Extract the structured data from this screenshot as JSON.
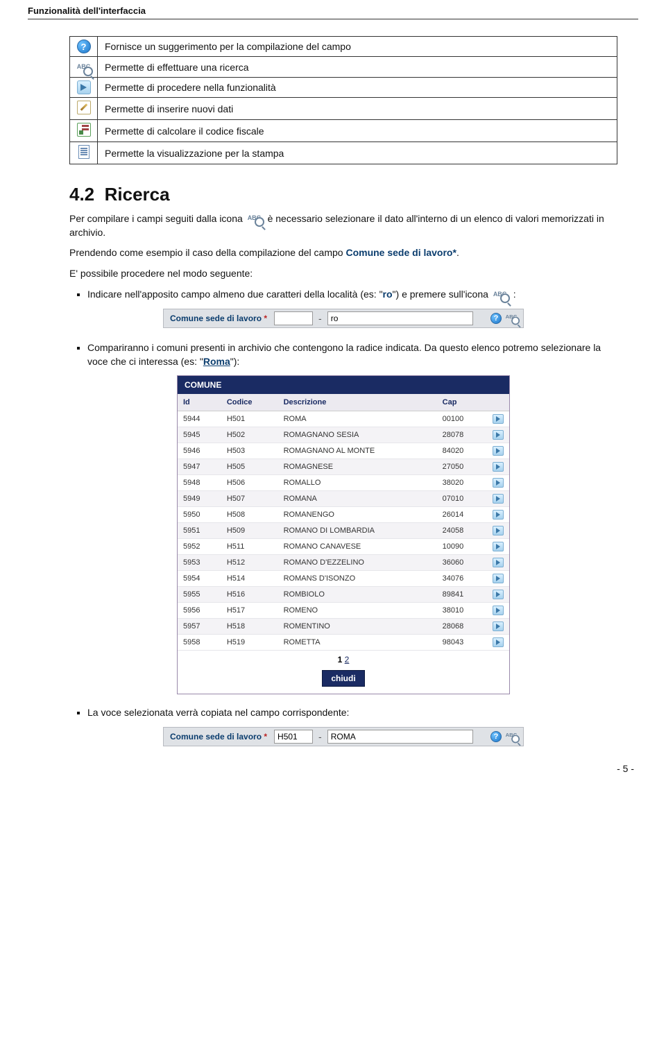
{
  "headerTitle": "Funzionalità dell'interfaccia",
  "iconsTable": [
    {
      "icon": "help",
      "desc": "Fornisce un suggerimento per la compilazione del campo"
    },
    {
      "icon": "abc",
      "desc": "Permette di effettuare una ricerca"
    },
    {
      "icon": "play",
      "desc": "Permette di procedere nella funzionalità"
    },
    {
      "icon": "edit",
      "desc": "Permette di inserire nuovi dati"
    },
    {
      "icon": "calc",
      "desc": "Permette di calcolare  il codice fiscale"
    },
    {
      "icon": "doc",
      "desc": "Permette la visualizzazione per la stampa"
    }
  ],
  "sectionNumber": "4.2",
  "sectionTitle": "Ricerca",
  "para1_a": "Per compilare i campi seguiti dalla icona",
  "para1_b": "è necessario selezionare il dato all'interno di un elenco di valori memorizzati in archivio.",
  "para2_a": "Prendendo come esempio il caso della compilazione del campo ",
  "para2_b": "Comune sede di lavoro*",
  "para2_c": ".",
  "para3": "E' possibile procedere nel modo seguente:",
  "bullet1_a": "Indicare nell'apposito campo almeno due caratteri della località (es: \"",
  "bullet1_b": "ro",
  "bullet1_c": "\") e premere sull'icona",
  "bullet1_d": ":",
  "field": {
    "label": "Comune sede di lavoro",
    "asterisk": "*",
    "codeVal": "",
    "nameVal1": "ro",
    "codeVal2": "H501",
    "nameVal2": "ROMA"
  },
  "bullet2_a": "Compariranno i comuni presenti in archivio che contengono la radice indicata. Da questo elenco potremo selezionare la voce che ci interessa (es: \"",
  "bullet2_b": "Roma",
  "bullet2_c": "\"):",
  "popup": {
    "title": "COMUNE",
    "cols": [
      "Id",
      "Codice",
      "Descrizione",
      "Cap"
    ],
    "rows": [
      [
        "5944",
        "H501",
        "ROMA",
        "00100"
      ],
      [
        "5945",
        "H502",
        "ROMAGNANO SESIA",
        "28078"
      ],
      [
        "5946",
        "H503",
        "ROMAGNANO AL MONTE",
        "84020"
      ],
      [
        "5947",
        "H505",
        "ROMAGNESE",
        "27050"
      ],
      [
        "5948",
        "H506",
        "ROMALLO",
        "38020"
      ],
      [
        "5949",
        "H507",
        "ROMANA",
        "07010"
      ],
      [
        "5950",
        "H508",
        "ROMANENGO",
        "26014"
      ],
      [
        "5951",
        "H509",
        "ROMANO DI LOMBARDIA",
        "24058"
      ],
      [
        "5952",
        "H511",
        "ROMANO CANAVESE",
        "10090"
      ],
      [
        "5953",
        "H512",
        "ROMANO D'EZZELINO",
        "36060"
      ],
      [
        "5954",
        "H514",
        "ROMANS D'ISONZO",
        "34076"
      ],
      [
        "5955",
        "H516",
        "ROMBIOLO",
        "89841"
      ],
      [
        "5956",
        "H517",
        "ROMENO",
        "38010"
      ],
      [
        "5957",
        "H518",
        "ROMENTINO",
        "28068"
      ],
      [
        "5958",
        "H519",
        "ROMETTA",
        "98043"
      ]
    ],
    "pagerCurrent": "1",
    "pagerNext": "2",
    "closeLabel": "chiudi"
  },
  "bullet3": "La voce selezionata verrà copiata nel campo corrispondente:",
  "pageNum": "- 5 -"
}
